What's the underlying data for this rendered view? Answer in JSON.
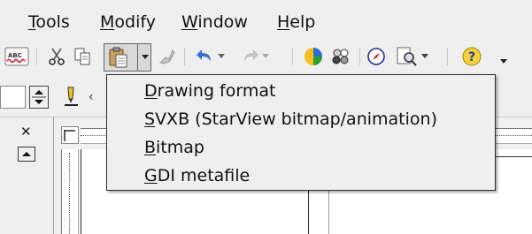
{
  "menubar": {
    "items": [
      {
        "prefix": "",
        "mnemonic": "T",
        "rest": "ools"
      },
      {
        "prefix": "",
        "mnemonic": "M",
        "rest": "odify"
      },
      {
        "prefix": "",
        "mnemonic": "W",
        "rest": "indow"
      },
      {
        "prefix": "",
        "mnemonic": "H",
        "rest": "elp"
      }
    ]
  },
  "paste_menu": {
    "items": [
      {
        "mnemonic": "D",
        "rest": "rawing format"
      },
      {
        "mnemonic": "S",
        "rest": "VXB (StarView bitmap/animation)"
      },
      {
        "mnemonic": "B",
        "rest": "itmap"
      },
      {
        "mnemonic": "G",
        "rest": "DI metafile"
      }
    ]
  },
  "toolbar": {
    "icons": [
      "spellcheck-icon",
      "cut-icon",
      "copy-icon",
      "paste-icon",
      "clone-formatting-icon",
      "undo-icon",
      "redo-icon",
      "chart-icon",
      "draw-functions-icon",
      "navigator-icon",
      "zoom-icon",
      "help-icon"
    ]
  },
  "colors": {
    "chrome": "#efefef",
    "menu_border": "#2c2c2c",
    "undo_blue": "#3a6fd0",
    "pressed_bg": "#d8d8d8"
  }
}
